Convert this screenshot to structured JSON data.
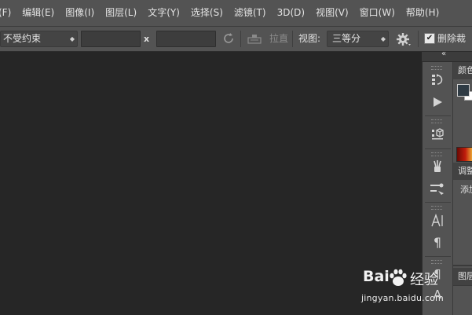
{
  "menubar": {
    "items": [
      "(F)",
      "编辑(E)",
      "图像(I)",
      "图层(L)",
      "文字(Y)",
      "选择(S)",
      "滤镜(T)",
      "3D(D)",
      "视图(V)",
      "窗口(W)",
      "帮助(H)"
    ]
  },
  "options": {
    "constraint_value": "不受约束",
    "width_value": "",
    "height_value": "",
    "x_label": "x",
    "straighten_label": "拉直",
    "view_label": "视图:",
    "view_value": "三等分",
    "delete_cropped_label": "删除裁剪",
    "delete_cropped_checked": true
  },
  "dock": {
    "collapse_glyph": "«",
    "color_tab": "颜色",
    "adjust_tab": "调整",
    "add_text": "添加",
    "layers_tab": "图层"
  },
  "strip_icons": [
    "history-icon",
    "play-icon",
    "3d-icon",
    "brush-presets-icon",
    "tool-presets-icon",
    "character-icon",
    "paragraph-icon",
    "paragraph-styles-icon",
    "character-styles-icon"
  ],
  "colors": {
    "foreground": "#2f3b44",
    "background": "#ffffff",
    "accent_gradient_start": "#c01c0c",
    "accent_gradient_end": "#f3c43e"
  },
  "watermark": {
    "brand_left": "Bai",
    "brand_right": "经验",
    "url": "jingyan.baidu.com"
  }
}
